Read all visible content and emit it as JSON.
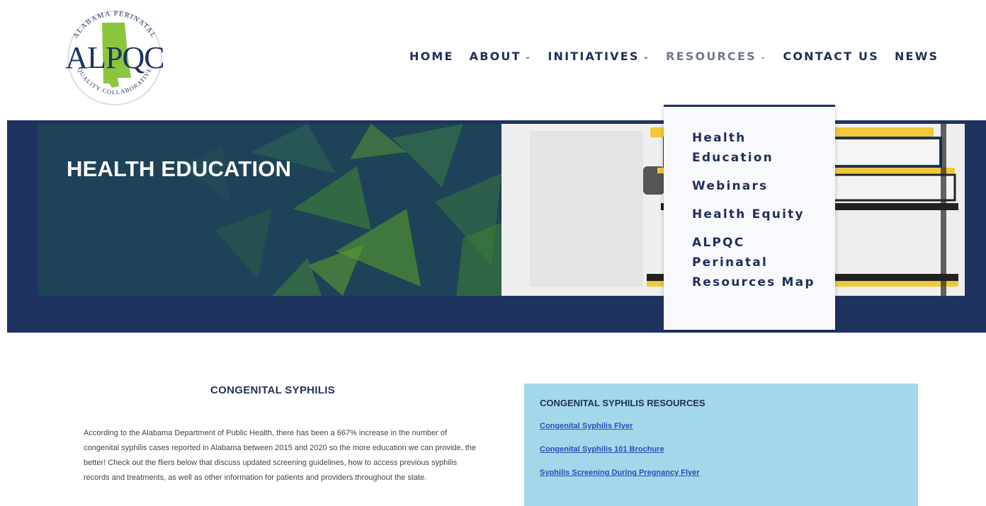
{
  "logo": {
    "arc_top": "ALABAMA PERINATAL",
    "arc_bottom": "QUALITY COLLABORATIVE",
    "wordmark": "ALPQC",
    "state_color": "#8cc63f",
    "ring_color": "#1f3360"
  },
  "nav": [
    {
      "label": "HOME",
      "dropdown": false
    },
    {
      "label": "ABOUT",
      "dropdown": true
    },
    {
      "label": "INITIATIVES",
      "dropdown": true
    },
    {
      "label": "RESOURCES",
      "dropdown": true
    },
    {
      "label": "CONTACT US",
      "dropdown": false
    },
    {
      "label": "NEWS",
      "dropdown": false
    }
  ],
  "chevron": "⌄",
  "dropdown": {
    "items": [
      "Health Education",
      "Webinars",
      "Health Equity",
      "ALPQC Perinatal Resources Map"
    ]
  },
  "hero": {
    "title": "HEALTH EDUCATION"
  },
  "content": {
    "section_title": "CONGENITAL SYPHILIS",
    "body": "According to the Alabama Department of Public Health, there has been a 667% increase in the number of congenital syphilis cases reported in Alabama between 2015 and 2020 so the more education we can provide, the better! Check out the fliers below that discuss updated screening guidelines, how to access previous syphilis records and treatments, as well as other information for patients and providers throughout the state.",
    "resources": {
      "title": "CONGENITAL SYPHILIS RESOURCES",
      "links": [
        "Congenital Syphilis Flyer",
        "Congenital Syphilis 101 Brochure",
        "Syphilis Screening During Pregnancy Flyer"
      ]
    }
  },
  "colors": {
    "navy": "#1f3360",
    "nav_text": "#1f2f5a",
    "hero_teal": "#1e4257",
    "accent_green": "#5a9b2f",
    "resource_bg": "#a3d7ea",
    "link": "#2b4fb5"
  }
}
